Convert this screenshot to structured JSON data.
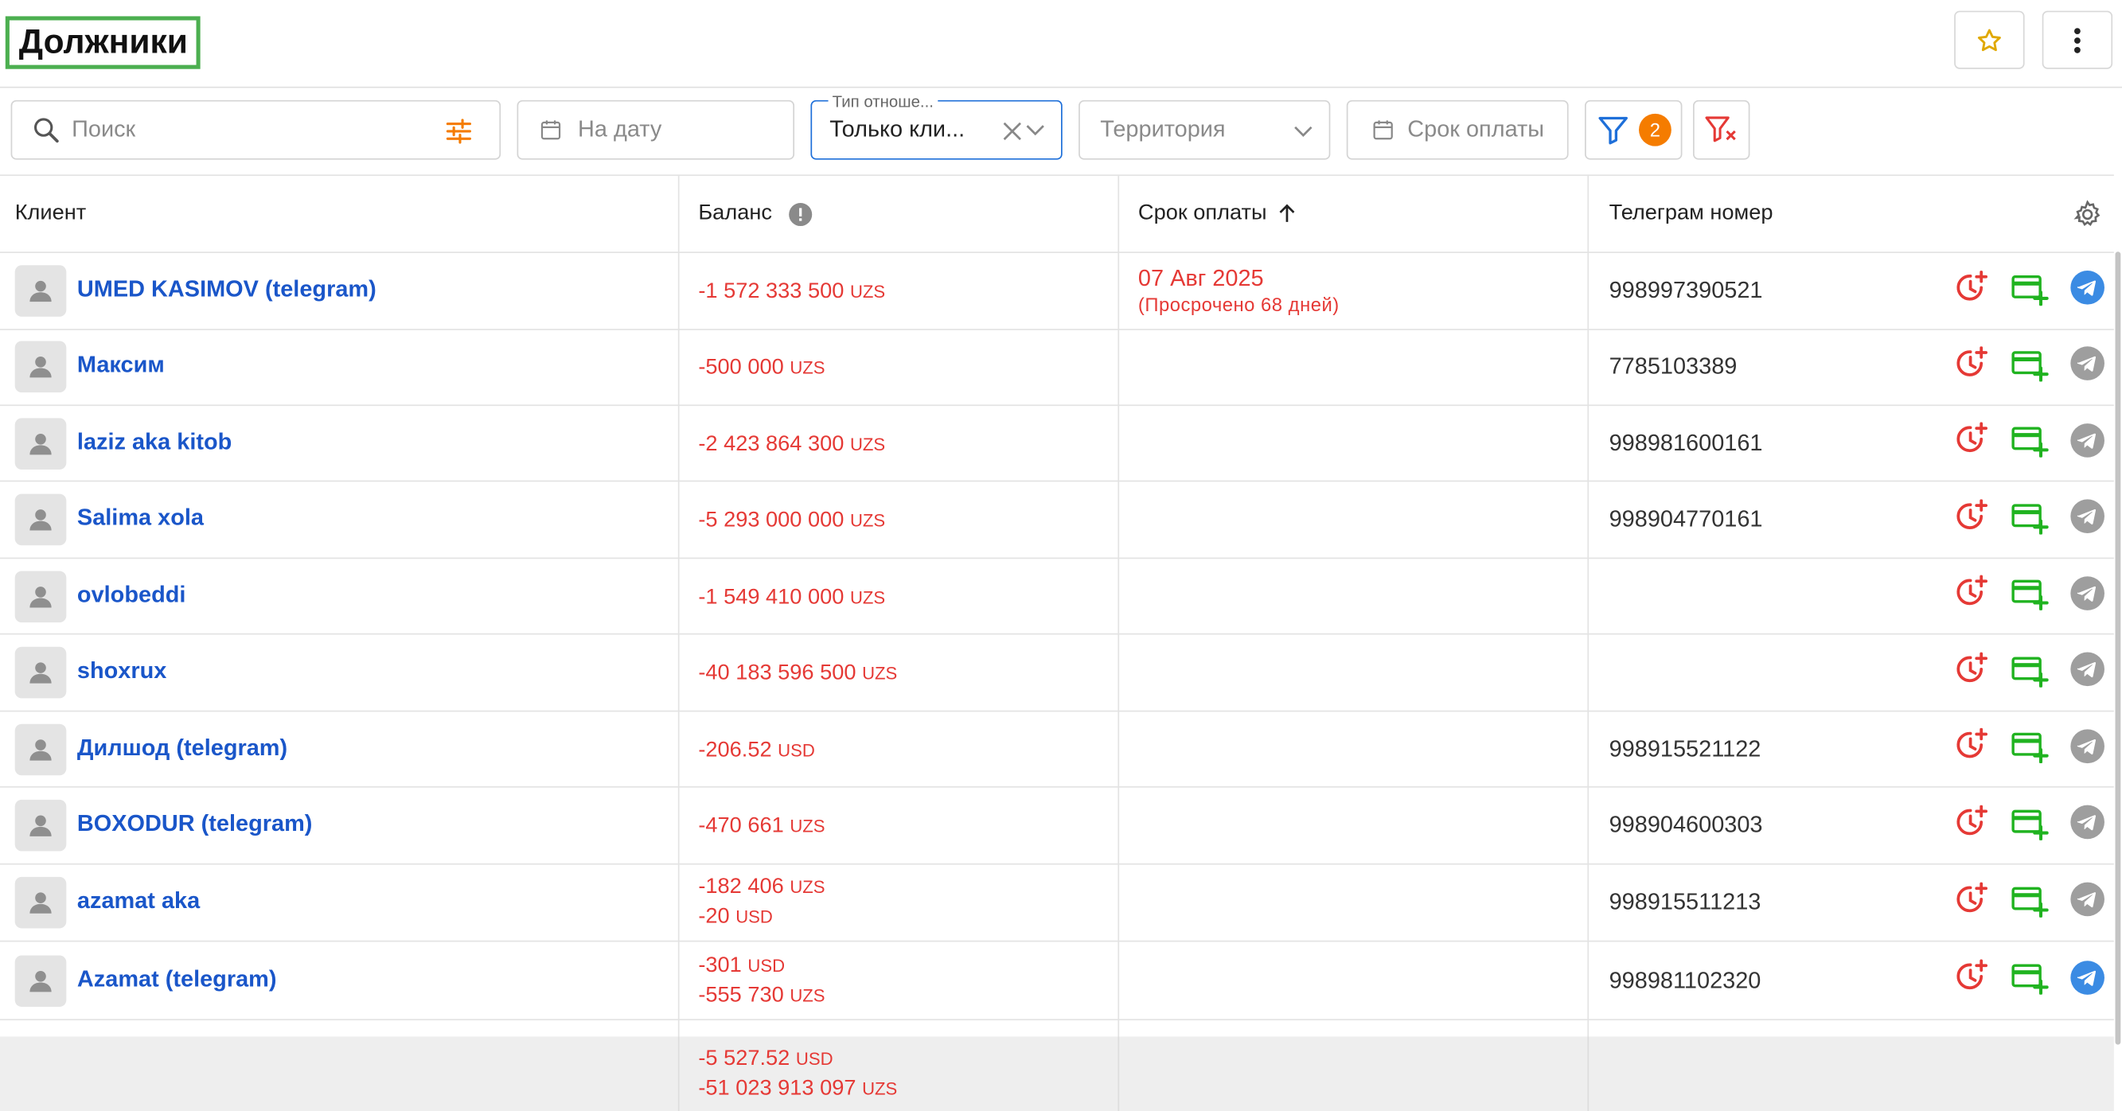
{
  "header": {
    "title": "Должники",
    "favorite_icon": "star-icon",
    "more_icon": "more-vertical-icon"
  },
  "filters": {
    "search": {
      "placeholder": "Поиск",
      "icon": "search-icon",
      "settings_icon": "sliders-icon"
    },
    "date": {
      "placeholder": "На дату",
      "icon": "calendar-icon"
    },
    "relation": {
      "label": "Тип отноше...",
      "value": "Только кли...",
      "clear_icon": "close-icon",
      "chevron_icon": "chevron-down-icon"
    },
    "territory": {
      "placeholder": "Территория",
      "chevron_icon": "chevron-down-icon"
    },
    "payment_term": {
      "placeholder": "Срок оплаты",
      "icon": "calendar-icon"
    },
    "filter_button": {
      "icon": "filter-icon",
      "badge": "2"
    },
    "clear_filter_button": {
      "icon": "filter-clear-icon"
    }
  },
  "colors": {
    "accent": "#1e6fd9",
    "link": "#1a56c9",
    "negative": "#e53935",
    "success": "#20b320",
    "badge": "#f57c00",
    "telegram_active": "#3b8be3",
    "telegram_inactive": "#9e9e9e",
    "title_outline": "#4caf50"
  },
  "table": {
    "columns": {
      "client": "Клиент",
      "balance": "Баланс",
      "due": "Срок оплаты",
      "telegram": "Телеграм номер"
    },
    "balance_info_icon": "info-icon",
    "sort_icon": "arrow-up-icon",
    "settings_icon": "gear-icon",
    "row_actions": [
      "clock-plus-icon",
      "card-plus-icon",
      "telegram-icon"
    ],
    "rows": [
      {
        "name": "UMED KASIMOV (telegram)",
        "balances": [
          {
            "amount": "-1 572 333 500",
            "currency": "UZS"
          }
        ],
        "due_date": "07 Авг 2025",
        "due_note": "(Просрочено 68 дней)",
        "telegram": "998997390521",
        "telegram_active": true
      },
      {
        "name": "Максим",
        "balances": [
          {
            "amount": "-500 000",
            "currency": "UZS"
          }
        ],
        "due_date": "",
        "due_note": "",
        "telegram": "7785103389",
        "telegram_active": false
      },
      {
        "name": "laziz aka kitob",
        "balances": [
          {
            "amount": "-2 423 864 300",
            "currency": "UZS"
          }
        ],
        "due_date": "",
        "due_note": "",
        "telegram": "998981600161",
        "telegram_active": false
      },
      {
        "name": "Salima xola",
        "balances": [
          {
            "amount": "-5 293 000 000",
            "currency": "UZS"
          }
        ],
        "due_date": "",
        "due_note": "",
        "telegram": "998904770161",
        "telegram_active": false
      },
      {
        "name": "ovlobeddi",
        "balances": [
          {
            "amount": "-1 549 410 000",
            "currency": "UZS"
          }
        ],
        "due_date": "",
        "due_note": "",
        "telegram": "",
        "telegram_active": false
      },
      {
        "name": "shoxrux",
        "balances": [
          {
            "amount": "-40 183 596 500",
            "currency": "UZS"
          }
        ],
        "due_date": "",
        "due_note": "",
        "telegram": "",
        "telegram_active": false
      },
      {
        "name": "Дилшод (telegram)",
        "balances": [
          {
            "amount": "-206.52",
            "currency": "USD"
          }
        ],
        "due_date": "",
        "due_note": "",
        "telegram": "998915521122",
        "telegram_active": false
      },
      {
        "name": "BOXODUR (telegram)",
        "balances": [
          {
            "amount": "-470 661",
            "currency": "UZS"
          }
        ],
        "due_date": "",
        "due_note": "",
        "telegram": "998904600303",
        "telegram_active": false
      },
      {
        "name": "azamat aka",
        "balances": [
          {
            "amount": "-182 406",
            "currency": "UZS"
          },
          {
            "amount": "-20",
            "currency": "USD"
          }
        ],
        "due_date": "",
        "due_note": "",
        "telegram": "998915511213",
        "telegram_active": false
      },
      {
        "name": "Azamat (telegram)",
        "balances": [
          {
            "amount": "-301",
            "currency": "USD"
          },
          {
            "amount": "-555 730",
            "currency": "UZS"
          }
        ],
        "due_date": "",
        "due_note": "",
        "telegram": "998981102320",
        "telegram_active": true
      }
    ],
    "totals": [
      {
        "amount": "-5 527.52",
        "currency": "USD"
      },
      {
        "amount": "-51 023 913 097",
        "currency": "UZS"
      }
    ]
  }
}
